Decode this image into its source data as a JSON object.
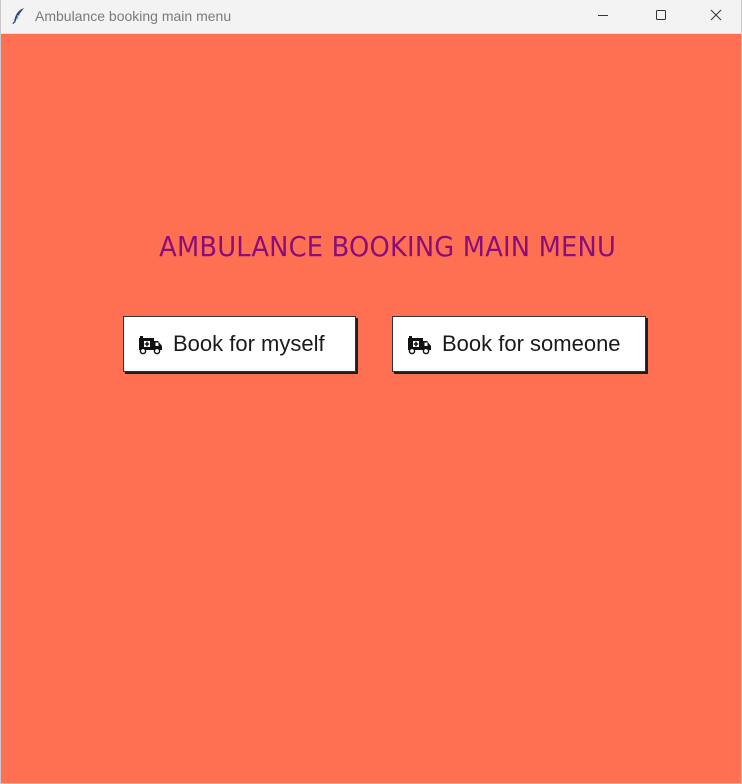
{
  "window": {
    "title": "Ambulance booking main menu",
    "background_color": "#ff7052",
    "app_icon": "feather-icon",
    "controls": {
      "minimize_icon": "minimize-icon",
      "maximize_icon": "maximize-icon",
      "close_icon": "close-icon"
    }
  },
  "main": {
    "heading": "AMBULANCE BOOKING MAIN MENU",
    "heading_color": "#8a0e7a",
    "buttons": [
      {
        "label": "Book for myself",
        "icon": "ambulance-icon"
      },
      {
        "label": "Book for someone",
        "icon": "ambulance-icon"
      }
    ]
  }
}
